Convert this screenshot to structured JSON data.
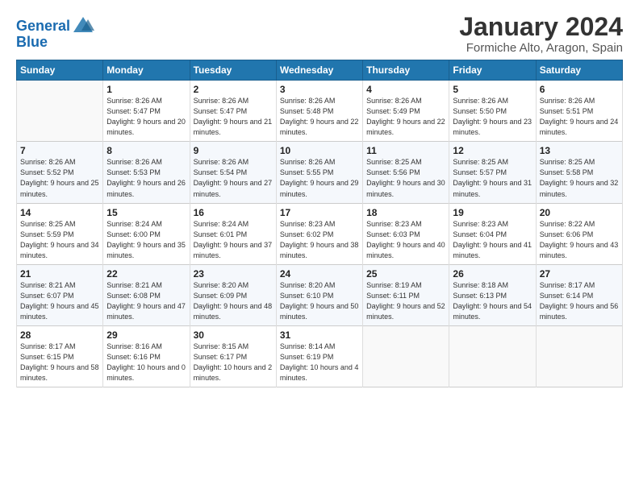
{
  "logo": {
    "line1": "General",
    "line2": "Blue"
  },
  "title": "January 2024",
  "location": "Formiche Alto, Aragon, Spain",
  "days_header": [
    "Sunday",
    "Monday",
    "Tuesday",
    "Wednesday",
    "Thursday",
    "Friday",
    "Saturday"
  ],
  "weeks": [
    [
      {
        "num": "",
        "sunrise": "",
        "sunset": "",
        "daylight": ""
      },
      {
        "num": "1",
        "sunrise": "Sunrise: 8:26 AM",
        "sunset": "Sunset: 5:47 PM",
        "daylight": "Daylight: 9 hours and 20 minutes."
      },
      {
        "num": "2",
        "sunrise": "Sunrise: 8:26 AM",
        "sunset": "Sunset: 5:47 PM",
        "daylight": "Daylight: 9 hours and 21 minutes."
      },
      {
        "num": "3",
        "sunrise": "Sunrise: 8:26 AM",
        "sunset": "Sunset: 5:48 PM",
        "daylight": "Daylight: 9 hours and 22 minutes."
      },
      {
        "num": "4",
        "sunrise": "Sunrise: 8:26 AM",
        "sunset": "Sunset: 5:49 PM",
        "daylight": "Daylight: 9 hours and 22 minutes."
      },
      {
        "num": "5",
        "sunrise": "Sunrise: 8:26 AM",
        "sunset": "Sunset: 5:50 PM",
        "daylight": "Daylight: 9 hours and 23 minutes."
      },
      {
        "num": "6",
        "sunrise": "Sunrise: 8:26 AM",
        "sunset": "Sunset: 5:51 PM",
        "daylight": "Daylight: 9 hours and 24 minutes."
      }
    ],
    [
      {
        "num": "7",
        "sunrise": "Sunrise: 8:26 AM",
        "sunset": "Sunset: 5:52 PM",
        "daylight": "Daylight: 9 hours and 25 minutes."
      },
      {
        "num": "8",
        "sunrise": "Sunrise: 8:26 AM",
        "sunset": "Sunset: 5:53 PM",
        "daylight": "Daylight: 9 hours and 26 minutes."
      },
      {
        "num": "9",
        "sunrise": "Sunrise: 8:26 AM",
        "sunset": "Sunset: 5:54 PM",
        "daylight": "Daylight: 9 hours and 27 minutes."
      },
      {
        "num": "10",
        "sunrise": "Sunrise: 8:26 AM",
        "sunset": "Sunset: 5:55 PM",
        "daylight": "Daylight: 9 hours and 29 minutes."
      },
      {
        "num": "11",
        "sunrise": "Sunrise: 8:25 AM",
        "sunset": "Sunset: 5:56 PM",
        "daylight": "Daylight: 9 hours and 30 minutes."
      },
      {
        "num": "12",
        "sunrise": "Sunrise: 8:25 AM",
        "sunset": "Sunset: 5:57 PM",
        "daylight": "Daylight: 9 hours and 31 minutes."
      },
      {
        "num": "13",
        "sunrise": "Sunrise: 8:25 AM",
        "sunset": "Sunset: 5:58 PM",
        "daylight": "Daylight: 9 hours and 32 minutes."
      }
    ],
    [
      {
        "num": "14",
        "sunrise": "Sunrise: 8:25 AM",
        "sunset": "Sunset: 5:59 PM",
        "daylight": "Daylight: 9 hours and 34 minutes."
      },
      {
        "num": "15",
        "sunrise": "Sunrise: 8:24 AM",
        "sunset": "Sunset: 6:00 PM",
        "daylight": "Daylight: 9 hours and 35 minutes."
      },
      {
        "num": "16",
        "sunrise": "Sunrise: 8:24 AM",
        "sunset": "Sunset: 6:01 PM",
        "daylight": "Daylight: 9 hours and 37 minutes."
      },
      {
        "num": "17",
        "sunrise": "Sunrise: 8:23 AM",
        "sunset": "Sunset: 6:02 PM",
        "daylight": "Daylight: 9 hours and 38 minutes."
      },
      {
        "num": "18",
        "sunrise": "Sunrise: 8:23 AM",
        "sunset": "Sunset: 6:03 PM",
        "daylight": "Daylight: 9 hours and 40 minutes."
      },
      {
        "num": "19",
        "sunrise": "Sunrise: 8:23 AM",
        "sunset": "Sunset: 6:04 PM",
        "daylight": "Daylight: 9 hours and 41 minutes."
      },
      {
        "num": "20",
        "sunrise": "Sunrise: 8:22 AM",
        "sunset": "Sunset: 6:06 PM",
        "daylight": "Daylight: 9 hours and 43 minutes."
      }
    ],
    [
      {
        "num": "21",
        "sunrise": "Sunrise: 8:21 AM",
        "sunset": "Sunset: 6:07 PM",
        "daylight": "Daylight: 9 hours and 45 minutes."
      },
      {
        "num": "22",
        "sunrise": "Sunrise: 8:21 AM",
        "sunset": "Sunset: 6:08 PM",
        "daylight": "Daylight: 9 hours and 47 minutes."
      },
      {
        "num": "23",
        "sunrise": "Sunrise: 8:20 AM",
        "sunset": "Sunset: 6:09 PM",
        "daylight": "Daylight: 9 hours and 48 minutes."
      },
      {
        "num": "24",
        "sunrise": "Sunrise: 8:20 AM",
        "sunset": "Sunset: 6:10 PM",
        "daylight": "Daylight: 9 hours and 50 minutes."
      },
      {
        "num": "25",
        "sunrise": "Sunrise: 8:19 AM",
        "sunset": "Sunset: 6:11 PM",
        "daylight": "Daylight: 9 hours and 52 minutes."
      },
      {
        "num": "26",
        "sunrise": "Sunrise: 8:18 AM",
        "sunset": "Sunset: 6:13 PM",
        "daylight": "Daylight: 9 hours and 54 minutes."
      },
      {
        "num": "27",
        "sunrise": "Sunrise: 8:17 AM",
        "sunset": "Sunset: 6:14 PM",
        "daylight": "Daylight: 9 hours and 56 minutes."
      }
    ],
    [
      {
        "num": "28",
        "sunrise": "Sunrise: 8:17 AM",
        "sunset": "Sunset: 6:15 PM",
        "daylight": "Daylight: 9 hours and 58 minutes."
      },
      {
        "num": "29",
        "sunrise": "Sunrise: 8:16 AM",
        "sunset": "Sunset: 6:16 PM",
        "daylight": "Daylight: 10 hours and 0 minutes."
      },
      {
        "num": "30",
        "sunrise": "Sunrise: 8:15 AM",
        "sunset": "Sunset: 6:17 PM",
        "daylight": "Daylight: 10 hours and 2 minutes."
      },
      {
        "num": "31",
        "sunrise": "Sunrise: 8:14 AM",
        "sunset": "Sunset: 6:19 PM",
        "daylight": "Daylight: 10 hours and 4 minutes."
      },
      {
        "num": "",
        "sunrise": "",
        "sunset": "",
        "daylight": ""
      },
      {
        "num": "",
        "sunrise": "",
        "sunset": "",
        "daylight": ""
      },
      {
        "num": "",
        "sunrise": "",
        "sunset": "",
        "daylight": ""
      }
    ]
  ]
}
